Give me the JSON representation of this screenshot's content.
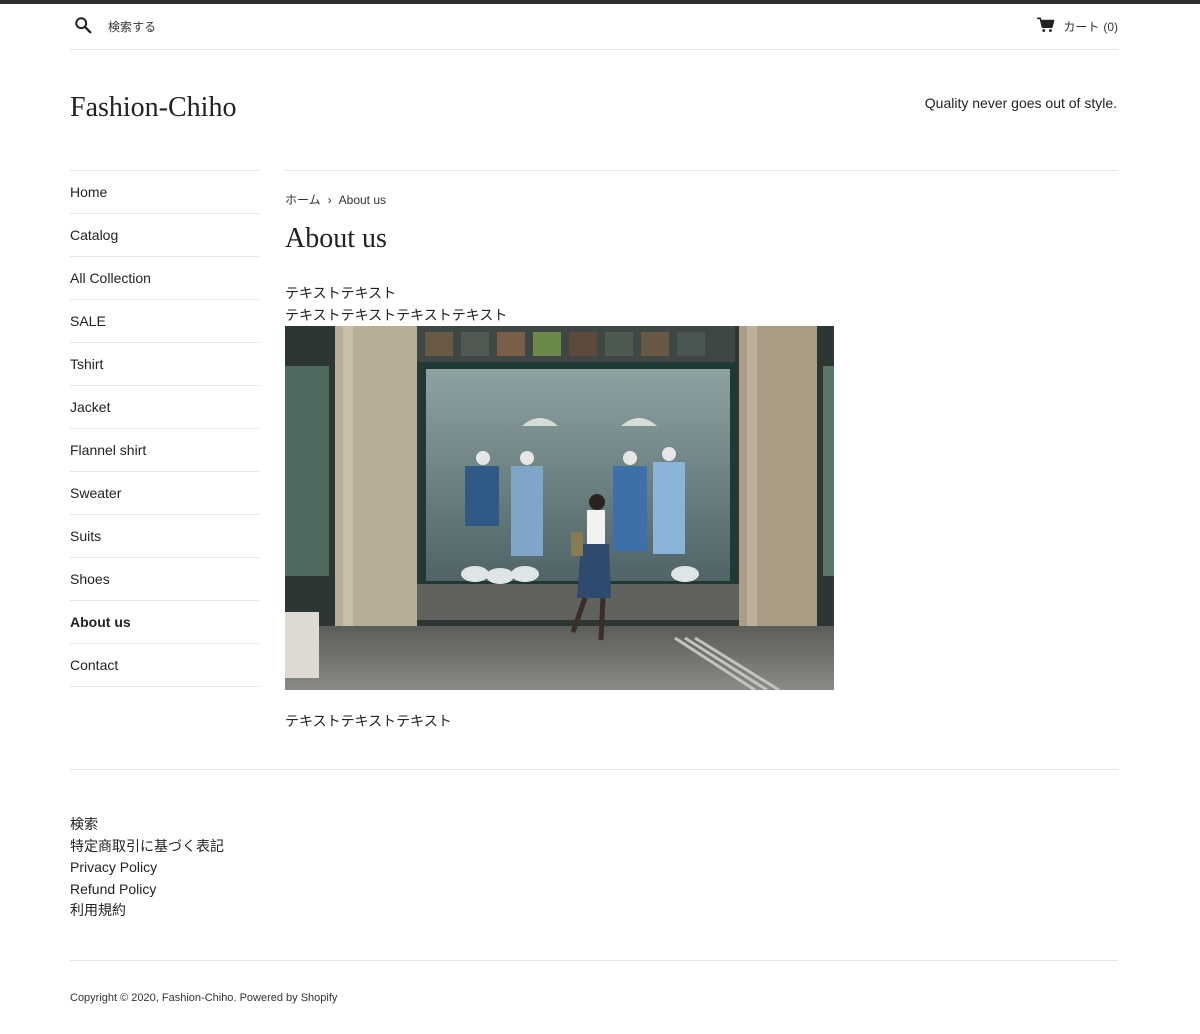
{
  "header": {
    "search_placeholder": "検索する",
    "cart_label": "カート",
    "cart_count": "(0)"
  },
  "site": {
    "title": "Fashion-Chiho",
    "tagline": "Quality never goes out of style."
  },
  "sidebar": {
    "items": [
      {
        "label": "Home"
      },
      {
        "label": "Catalog"
      },
      {
        "label": "All Collection"
      },
      {
        "label": "SALE"
      },
      {
        "label": "Tshirt"
      },
      {
        "label": "Jacket"
      },
      {
        "label": "Flannel shirt"
      },
      {
        "label": "Sweater"
      },
      {
        "label": "Suits"
      },
      {
        "label": "Shoes"
      },
      {
        "label": "About us"
      },
      {
        "label": "Contact"
      }
    ],
    "active_label": "About us"
  },
  "breadcrumb": {
    "home": "ホーム",
    "separator": "›",
    "current": "About us"
  },
  "main": {
    "title": "About us",
    "text_line1": "テキストテキスト",
    "text_line2": "テキストテキストテキストテキスト",
    "text_after_image": "テキストテキストテキスト"
  },
  "footer": {
    "links": [
      {
        "label": "検索"
      },
      {
        "label": "特定商取引に基づく表記"
      },
      {
        "label": "Privacy Policy"
      },
      {
        "label": "Refund Policy"
      },
      {
        "label": "利用規約"
      }
    ],
    "copyright_prefix": "Copyright © 2020,",
    "copyright_site": "Fashion-Chiho",
    "powered_by": "Powered by Shopify"
  },
  "colors": {
    "text": "#222222",
    "divider": "#e6e6e6",
    "top_bar": "#2e2e2e"
  },
  "icons": {
    "search": "search-icon",
    "cart": "cart-icon"
  }
}
